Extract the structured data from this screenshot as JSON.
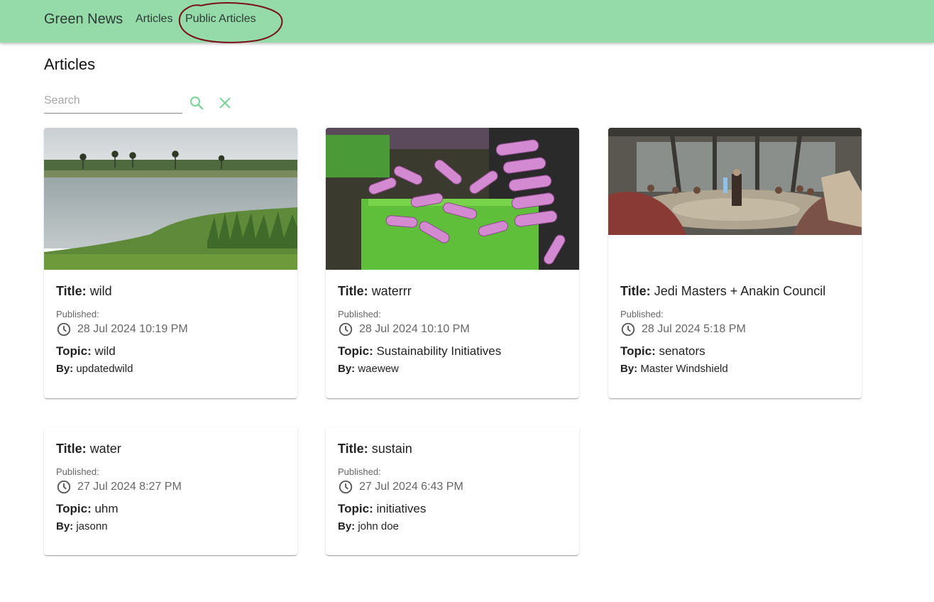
{
  "header": {
    "brand": "Green News",
    "nav": {
      "articles": "Articles",
      "public_articles": "Public Articles"
    }
  },
  "main": {
    "title": "Articles",
    "search": {
      "placeholder": "Search",
      "value": ""
    }
  },
  "labels": {
    "title": "Title:",
    "published": "Published:",
    "topic": "Topic:",
    "by": "By:"
  },
  "articles": [
    {
      "title": "wild",
      "date": "28 Jul 2024 10:19 PM",
      "topic": "wild",
      "author": "updatedwild"
    },
    {
      "title": "waterrr",
      "date": "28 Jul 2024 10:10 PM",
      "topic": "Sustainability Initiatives",
      "author": "waewew"
    },
    {
      "title": "Jedi Masters + Anakin Council",
      "date": "28 Jul 2024 5:18 PM",
      "topic": "senators",
      "author": "Master Windshield"
    },
    {
      "title": "water",
      "date": "27 Jul 2024 8:27 PM",
      "topic": "uhm",
      "author": "jasonn"
    },
    {
      "title": "sustain",
      "date": "27 Jul 2024 6:43 PM",
      "topic": "initiatives",
      "author": "john doe"
    }
  ],
  "colors": {
    "header_bg": "#94dba9",
    "icon_green": "#7fd39b",
    "annotation_red": "#7a0f17"
  },
  "icons": {
    "search": "search-icon",
    "clear": "close-icon",
    "clock": "clock-icon"
  }
}
